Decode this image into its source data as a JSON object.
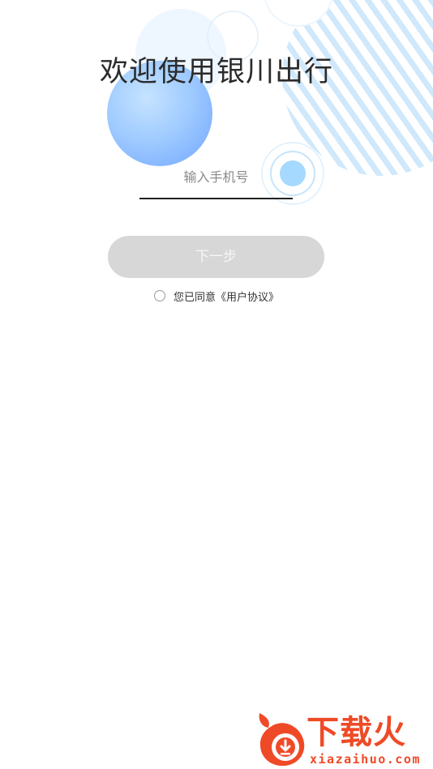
{
  "header": {
    "title": "欢迎使用银川出行"
  },
  "login": {
    "phone_placeholder": "输入手机号",
    "phone_value": "",
    "next_label": "下一步",
    "agree_prefix": "您已同意",
    "agreement_link": "《用户协议》",
    "agree_checked": false
  },
  "watermark": {
    "brand": "下载火",
    "url": "xiazaihuo.com"
  },
  "colors": {
    "accent_blue": "#8ec9ff",
    "button_disabled": "#d8d7d8",
    "watermark": "#ef4a27"
  }
}
